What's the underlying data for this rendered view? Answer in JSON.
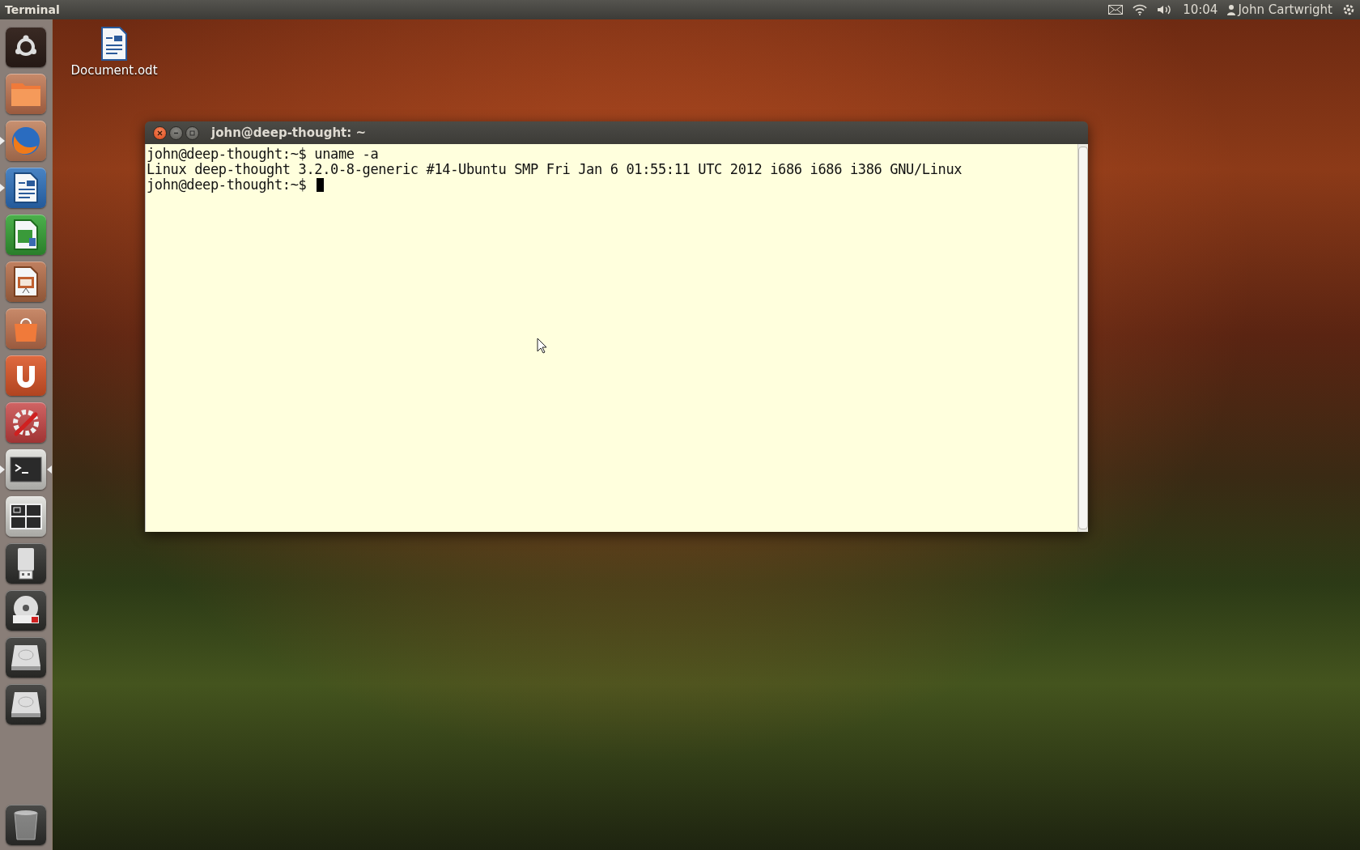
{
  "panel": {
    "app_title": "Terminal",
    "clock": "10:04",
    "user": "John Cartwright"
  },
  "launcher": [
    {
      "kind": "dash",
      "running": false,
      "focused": false
    },
    {
      "kind": "files",
      "running": false,
      "focused": false
    },
    {
      "kind": "browser",
      "running": true,
      "focused": false
    },
    {
      "kind": "writer",
      "running": true,
      "focused": false
    },
    {
      "kind": "calc",
      "running": false,
      "focused": false
    },
    {
      "kind": "impress",
      "running": false,
      "focused": false
    },
    {
      "kind": "store",
      "running": false,
      "focused": false
    },
    {
      "kind": "cloud",
      "running": false,
      "focused": false
    },
    {
      "kind": "settings",
      "running": false,
      "focused": false
    },
    {
      "kind": "terminal",
      "running": true,
      "focused": true
    },
    {
      "kind": "workspaces",
      "running": false,
      "focused": false
    },
    {
      "kind": "usb",
      "running": false,
      "focused": false
    },
    {
      "kind": "dvd",
      "running": false,
      "focused": false
    },
    {
      "kind": "drive",
      "running": false,
      "focused": false
    },
    {
      "kind": "drive",
      "running": false,
      "focused": false
    },
    {
      "kind": "trash",
      "running": false,
      "focused": false
    }
  ],
  "desktop_icons": [
    {
      "label": "Document.odt"
    }
  ],
  "terminal": {
    "title": "john@deep-thought: ~",
    "lines": [
      {
        "kind": "prompt",
        "prompt": "john@deep-thought:~$",
        "command": "uname -a",
        "cursor": false
      },
      {
        "kind": "output",
        "text": "Linux deep-thought 3.2.0-8-generic #14-Ubuntu SMP Fri Jan 6 01:55:11 UTC 2012 i686 i686 i386 GNU/Linux"
      },
      {
        "kind": "prompt",
        "prompt": "john@deep-thought:~$",
        "cursor": true
      }
    ]
  }
}
